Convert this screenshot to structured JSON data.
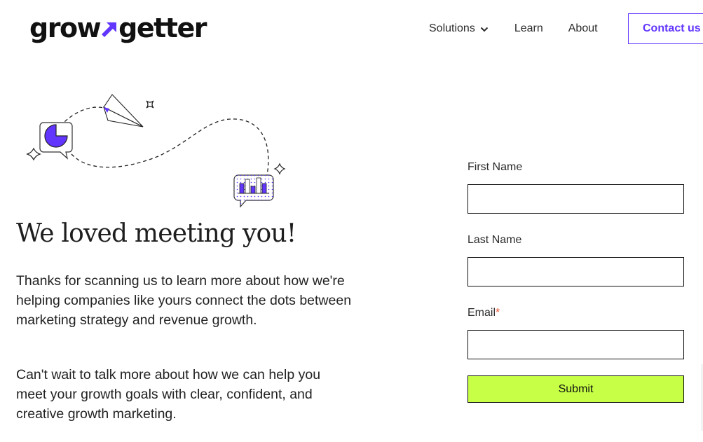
{
  "header": {
    "logo": {
      "text_left": "grow",
      "text_right": "getter",
      "arrow_icon": "arrow-up-right-icon"
    },
    "nav": [
      {
        "label": "Solutions",
        "has_dropdown": true
      },
      {
        "label": "Learn",
        "has_dropdown": false
      },
      {
        "label": "About",
        "has_dropdown": false
      }
    ],
    "contact_button": "Contact us"
  },
  "hero": {
    "illustration": {
      "icons": [
        "pie-chart-bubble-icon",
        "paper-plane-icon",
        "bar-chart-bubble-icon",
        "sparkle-icon"
      ]
    },
    "headline": "We loved meeting you!",
    "paragraphs": [
      "Thanks for scanning us to learn more about how we're helping companies like yours connect the dots between marketing strategy and revenue growth.",
      "Can't wait to talk more about how we can help you meet your growth goals with clear, confident, and creative growth marketing."
    ]
  },
  "form": {
    "fields": [
      {
        "label": "First Name",
        "required": false,
        "value": "",
        "placeholder": ""
      },
      {
        "label": "Last Name",
        "required": false,
        "value": "",
        "placeholder": ""
      },
      {
        "label": "Email",
        "required": true,
        "required_mark": "*",
        "value": "",
        "placeholder": ""
      }
    ],
    "submit_label": "Submit"
  },
  "colors": {
    "brand_purple": "#6236ff",
    "submit_green": "#c6ff45",
    "required_red": "#e8542f",
    "text_dark": "#222222"
  }
}
